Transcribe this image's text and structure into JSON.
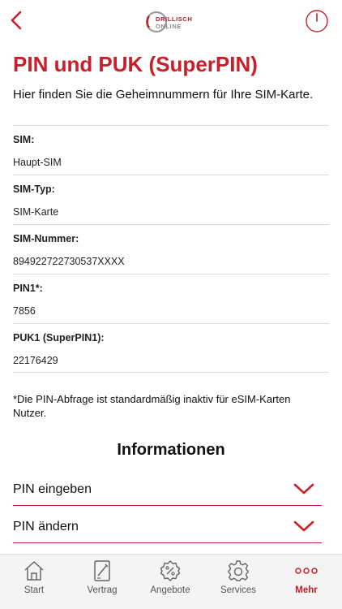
{
  "header": {
    "logo_line1": "DRILLISCH",
    "logo_line2": "ONLINE"
  },
  "page": {
    "title": "PIN und PUK (SuperPIN)",
    "subtitle": "Hier finden Sie die Geheimnummern für Ihre SIM-Karte."
  },
  "info": [
    {
      "label": "SIM:",
      "value": "Haupt-SIM"
    },
    {
      "label": "SIM-Typ:",
      "value": "SIM-Karte"
    },
    {
      "label": "SIM-Nummer:",
      "value": "894922722730537XXXX"
    },
    {
      "label": "PIN1*:",
      "value": "7856"
    },
    {
      "label": "PUK1 (SuperPIN1):",
      "value": "22176429"
    }
  ],
  "footnote": "*Die PIN-Abfrage ist standardmäßig inaktiv für eSIM-Karten Nutzer.",
  "informationen": {
    "title": "Informationen",
    "items": [
      {
        "label": "PIN eingeben"
      },
      {
        "label": "PIN ändern"
      }
    ]
  },
  "tabbar": {
    "tabs": [
      {
        "label": "Start",
        "icon": "home-icon"
      },
      {
        "label": "Vertrag",
        "icon": "contract-icon"
      },
      {
        "label": "Angebote",
        "icon": "offers-icon"
      },
      {
        "label": "Services",
        "icon": "gear-icon"
      },
      {
        "label": "Mehr",
        "icon": "more-icon"
      }
    ],
    "active": "Mehr"
  },
  "colors": {
    "accent": "#c8202a",
    "divider": "#dcdcdc",
    "tab_inactive": "#555555"
  }
}
